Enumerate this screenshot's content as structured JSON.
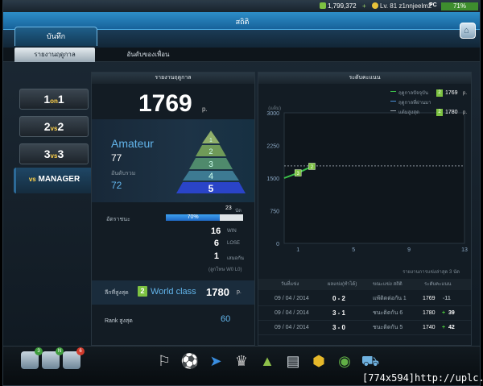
{
  "status_bar": {
    "money": "1,799,372",
    "plus": "+",
    "level": "Lv. 81",
    "username": "z1nnjeelm2",
    "platform": "PC",
    "battery": "71%"
  },
  "header": {
    "title": "สถิติ",
    "main_tab": "บันทึก"
  },
  "subtabs": {
    "active": "รายงานฤดูกาล",
    "other": "อันดับของเพื่อน"
  },
  "nav": {
    "btn_1on1_big": "1",
    "btn_1on1_small": "on",
    "btn_1on1_big2": "1",
    "btn_2vs2_big": "2",
    "btn_2vs2_small": "vs",
    "btn_2vs2_big2": "2",
    "btn_3vs3_big": "3",
    "btn_3vs3_small": "vs",
    "btn_3vs3_big2": "3",
    "btn_manager_small": "vs",
    "btn_manager_label": "MANAGER"
  },
  "season": {
    "panel_title": "รายงานฤดูกาล",
    "score": "1769",
    "score_unit": "p.",
    "league": "Amateur",
    "league_points": "77",
    "rank_label": "อันดับรวม",
    "rank_value": "72",
    "pyramid_levels": [
      "1",
      "2",
      "3",
      "4",
      "5"
    ],
    "games_played": "23",
    "games_unit": "นัด",
    "winrate_label": "อัตราชนะ",
    "winrate_text": "70%",
    "winrate_pct": 70,
    "wins": "16",
    "wins_label": "WIN",
    "losses": "6",
    "losses_label": "LOSE",
    "draws": "1",
    "draws_label": "เสมอกัน",
    "wdl_note": "(ลูกโทษ W0 L0)",
    "best_label": "ลีกที่สูงสุด",
    "best_badge": "2",
    "best_league": "World class",
    "best_score": "1780",
    "best_unit": "p.",
    "high_rank_label": "Rank สูงสุด",
    "high_rank_value": "60"
  },
  "chart_panel": {
    "title": "ระดับคะแนน",
    "legend": [
      {
        "label": "ฤดูกาลปัจจุบัน",
        "badge": "2",
        "value": "1769",
        "unit": "p."
      },
      {
        "label": "ฤดูกาลที่ผ่านมา",
        "badge": "",
        "value": "",
        "unit": ""
      },
      {
        "label": "แต้มสูงสุด",
        "badge": "2",
        "value": "1780",
        "unit": "p."
      }
    ],
    "history_note": "รายงานการแข่งล่าสุด 3 นัด",
    "history_headers": [
      "วันที่แข่ง",
      "ผลแข่ง(ทำได้)",
      "ขณะแข่ง สถิติ",
      "ระดับคะแนน"
    ],
    "history_rows": [
      {
        "date": "09 / 04 / 2014",
        "score": "0 - 2",
        "streak": "แพ้ติดต่อกัน 1",
        "points": "1769",
        "delta_sign": "-",
        "delta": "-11"
      },
      {
        "date": "09 / 04 / 2014",
        "score": "3 - 1",
        "streak": "ชนะติดกัน 6",
        "points": "1780",
        "delta_sign": "+",
        "delta": "39"
      },
      {
        "date": "09 / 04 / 2014",
        "score": "3 - 0",
        "streak": "ชนะติดกัน 5",
        "points": "1740",
        "delta_sign": "+",
        "delta": "42"
      }
    ]
  },
  "chart_data": {
    "type": "line",
    "y_unit": "(แต้ม)",
    "x_ticks": [
      "1",
      "5",
      "9",
      "13"
    ],
    "y_ticks": [
      "0",
      "750",
      "1500",
      "2250",
      "3000"
    ],
    "ylim": [
      0,
      3000
    ],
    "xlim": [
      0,
      13
    ],
    "series": [
      {
        "name": "ฤดูกาลปัจจุบัน",
        "x": [
          0,
          1,
          2
        ],
        "y": [
          1500,
          1620,
          1769
        ],
        "color": "#3cc24a",
        "point_labels": [
          "",
          "3",
          "2"
        ]
      }
    ],
    "max_line": {
      "name": "แต้มสูงสุด",
      "y": 1780
    }
  },
  "watermark": "[774x594]http://uplc.me/",
  "dock_icons": [
    "whistle-icon",
    "ball-icon",
    "boots-icon",
    "trophy-icon",
    "league-pyramid-icon",
    "cards-icon",
    "gold-medal-icon",
    "points-icon",
    "shop-cart-icon"
  ],
  "left_icons": [
    {
      "name": "profile-icon",
      "badge": "3",
      "badge_color": "#3e9b3c"
    },
    {
      "name": "friends-icon",
      "badge": "N",
      "badge_color": "#3e9b3c"
    },
    {
      "name": "mail-icon",
      "badge": "6",
      "badge_color": "#d03b2c"
    }
  ]
}
